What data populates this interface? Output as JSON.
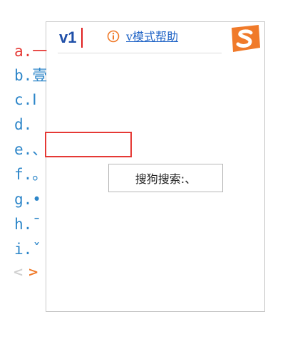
{
  "ime": {
    "composition": "v1",
    "help_text": "v模式帮助",
    "icons": {
      "help": "info-circle-icon",
      "logo": "sogou-logo-icon"
    },
    "colors": {
      "composition": "#1f4fa8",
      "candidate": "#2d86c9",
      "active_candidate": "#e53935",
      "highlight": "#e53935",
      "help_icon": "#f07a2a",
      "logo": "#f07a2a",
      "pager_next": "#f07a2a"
    },
    "candidates": [
      {
        "label": "a.",
        "text": "一"
      },
      {
        "label": "b.",
        "text": "壹"
      },
      {
        "label": "c.",
        "text": "Ⅰ"
      },
      {
        "label": "d.",
        "text": ""
      },
      {
        "label": "e.",
        "text": "、"
      },
      {
        "label": "f.",
        "text": "。"
      },
      {
        "label": "g.",
        "text": "•"
      },
      {
        "label": "h.",
        "text": "¯"
      },
      {
        "label": "i.",
        "text": "ˇ"
      }
    ],
    "active_index": 0,
    "highlighted_index": 3,
    "tooltip": "搜狗搜索:、",
    "pager": {
      "prev": "<",
      "next": ">"
    }
  }
}
